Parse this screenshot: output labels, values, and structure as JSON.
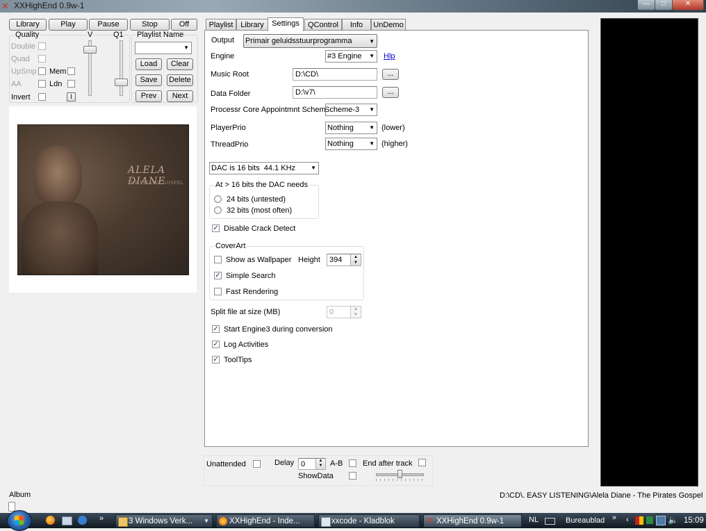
{
  "window": {
    "title": "XXHighEnd 0.9w-1"
  },
  "toolbar": {
    "library": "Library",
    "play": "Play",
    "pause": "Pause",
    "stop": "Stop",
    "off": "Off"
  },
  "quality": {
    "header": "Quality",
    "v_label": "V",
    "q1_label": "Q1",
    "double": "Double",
    "quad": "Quad",
    "upsmp": "UpSmp",
    "mem": "Mem",
    "aa": "AA",
    "ldn": "Ldn",
    "invert": "Invert",
    "i_button": "I"
  },
  "playlist": {
    "name_label": "Playlist Name",
    "name_value": "",
    "load": "Load",
    "clear": "Clear",
    "save": "Save",
    "delete": "Delete",
    "prev": "Prev",
    "next": "Next"
  },
  "cover": {
    "artist_text": "ALELA DIANE",
    "album_text": "THE PIRATES GOSPEL"
  },
  "tabs": [
    "Playlist",
    "Library",
    "Settings",
    "QControl",
    "Info",
    "UnDemo"
  ],
  "settings": {
    "output_label": "Output",
    "output_value": "Primair geluidsstuurprogramma",
    "engine_label": "Engine",
    "engine_value": "#3 Engine",
    "hlp_link": "Hlp",
    "music_root_label": "Music Root",
    "music_root_value": "D:\\CD\\",
    "browse": "...",
    "data_folder_label": "Data Folder",
    "data_folder_value": "D:\\v7\\",
    "core_label": "Processr Core Appointmnt Scheme",
    "core_value": "Scheme-3",
    "player_prio_label": "PlayerPrio",
    "player_prio_value": "Nothing",
    "player_prio_note": "(lower)",
    "thread_prio_label": "ThreadPrio",
    "thread_prio_value": "Nothing",
    "thread_prio_note": "(higher)",
    "dac_value": "DAC is 16 bits  44.1 KHz",
    "dac_group_label": "At > 16 bits the DAC needs",
    "bits24": "24 bits (untested)",
    "bits32": "32 bits (most often)",
    "crack_detect": "Disable Crack Detect",
    "coverart_label": "CoverArt",
    "show_wallpaper": "Show as Wallpaper",
    "height_label": "Height",
    "height_value": "394",
    "simple_search": "Simple Search",
    "fast_rendering": "Fast Rendering",
    "split_label": "Split file at size (MB)",
    "split_value": "0",
    "start_engine3": "Start Engine3 during conversion",
    "log_activities": "Log Activities",
    "tooltips": "ToolTips"
  },
  "bottom": {
    "unattended": "Unattended",
    "delay_label": "Delay",
    "delay_value": "0",
    "ab": "A-B",
    "end_after_track": "End after track",
    "show_data": "ShowData"
  },
  "status": {
    "album_label": "Album",
    "path": "D:\\CD\\. EASY LISTENING\\Alela Diane - The Pirates Gospel"
  },
  "taskbar": {
    "task1": "3 Windows Verk...",
    "task2": "XXHighEnd - Inde...",
    "task3": "xxcode - Kladblok",
    "task4": "XXHighEnd 0.9w-1",
    "lang": "NL",
    "desktop": "Bureaublad",
    "clock": "15:09"
  },
  "colors": {
    "accent_link": "#0000cc",
    "title_bar": "#7f8f9c",
    "taskbar": "#1d2833"
  }
}
